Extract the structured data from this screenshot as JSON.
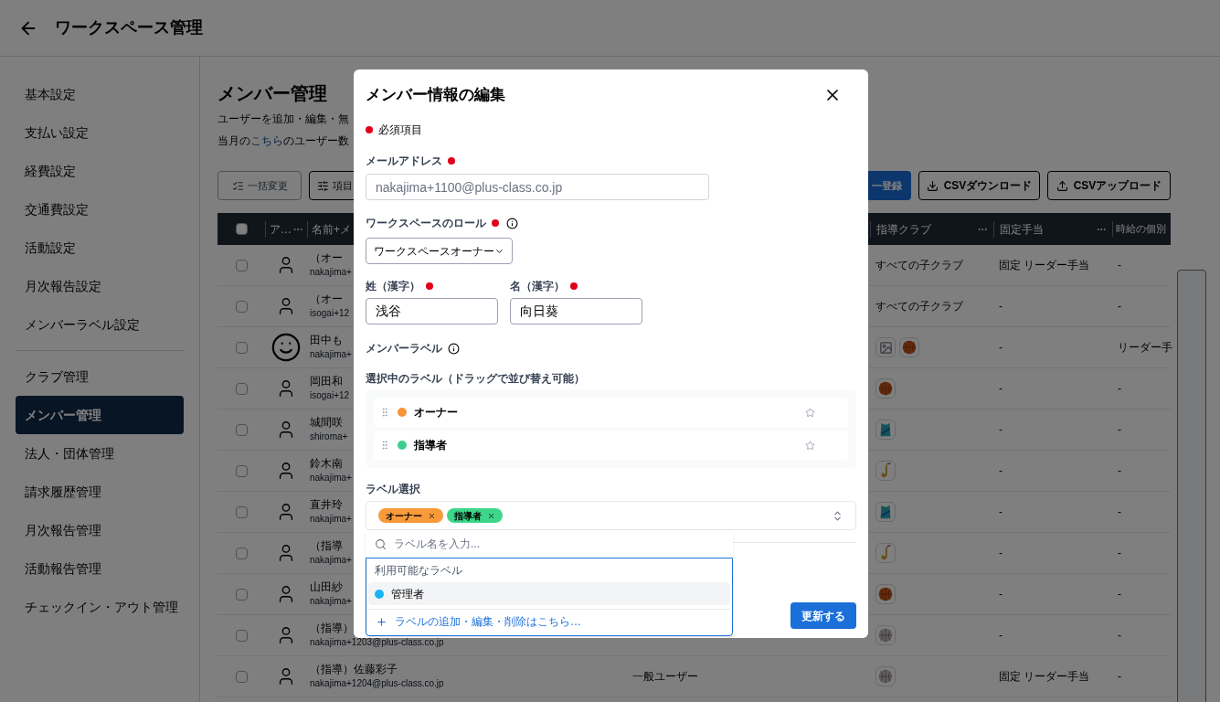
{
  "header": {
    "title": "ワークスペース管理"
  },
  "sidebar": {
    "groups": [
      [
        {
          "label": "基本設定",
          "selected": false
        },
        {
          "label": "支払い設定",
          "selected": false
        },
        {
          "label": "経費設定",
          "selected": false
        },
        {
          "label": "交通費設定",
          "selected": false
        },
        {
          "label": "活動設定",
          "selected": false
        },
        {
          "label": "月次報告設定",
          "selected": false
        },
        {
          "label": "メンバーラベル設定",
          "selected": false
        }
      ],
      [
        {
          "label": "クラブ管理",
          "selected": false
        },
        {
          "label": "メンバー管理",
          "selected": true
        },
        {
          "label": "法人・団体管理",
          "selected": false
        },
        {
          "label": "請求履歴管理",
          "selected": false
        },
        {
          "label": "月次報告管理",
          "selected": false
        },
        {
          "label": "活動報告管理",
          "selected": false
        },
        {
          "label": "チェックイン・アウト管理",
          "selected": false
        }
      ]
    ]
  },
  "page": {
    "title": "メンバー管理",
    "description": "ユーザーを追加・編集・無",
    "note_before": "当月の",
    "note_link": "こちら",
    "note_after": "のユーザー数"
  },
  "toolbar_left": [
    {
      "label": "一括変更",
      "kind": "bulk",
      "disabled": true
    },
    {
      "label": "項目",
      "kind": "columns",
      "disabled": false
    }
  ],
  "toolbar_right": [
    {
      "label": "一登録",
      "kind": "primary"
    },
    {
      "label": "CSVダウンロード",
      "kind": "download"
    },
    {
      "label": "CSVアップロード",
      "kind": "upload"
    }
  ],
  "table": {
    "select_all_checked": false,
    "columns": [
      {
        "label": "ア…"
      },
      {
        "label": "名前+メ"
      },
      {
        "label": "指導クラブ"
      },
      {
        "label": "固定手当"
      },
      {
        "label": "時給の個別"
      }
    ],
    "rows": [
      {
        "checked": false,
        "kind": "person",
        "name": "（オー",
        "email": "nakajima+",
        "club_text": "すべての子クラブ",
        "fixed": "固定 リーダー手当",
        "hourly": "-"
      },
      {
        "checked": false,
        "kind": "person",
        "name": "（オー",
        "email": "isogai+12",
        "club_text": "すべての子クラブ",
        "fixed": "-",
        "hourly": "-"
      },
      {
        "checked": false,
        "kind": "smiley",
        "name": "田中も",
        "email": "nakajima+",
        "club_icons": [
          {
            "kind": "image"
          },
          {
            "kind": "ball"
          }
        ],
        "fixed": "-",
        "hourly": "リーダー手"
      },
      {
        "checked": false,
        "kind": "person",
        "name": "岡田和",
        "email": "isogai+12",
        "club_icons": [
          {
            "kind": "ball"
          }
        ],
        "fixed": "-",
        "hourly": "-"
      },
      {
        "checked": false,
        "kind": "person",
        "name": "城間咲",
        "email": "shiroma+",
        "club_icons": [
          {
            "kind": "shirt"
          }
        ],
        "fixed": "-",
        "hourly": "-"
      },
      {
        "checked": false,
        "kind": "person",
        "name": "鈴木南",
        "email": "nakajima+",
        "club_icons": [
          {
            "kind": "sax"
          }
        ],
        "fixed": "-",
        "hourly": "-"
      },
      {
        "checked": false,
        "kind": "person",
        "name": "直井玲",
        "email": "nakajima+",
        "club_icons": [
          {
            "kind": "shirt"
          }
        ],
        "fixed": "-",
        "hourly": "-"
      },
      {
        "checked": false,
        "kind": "person",
        "name": "（指導",
        "email": "nakajima+",
        "club_icons": [
          {
            "kind": "sax"
          }
        ],
        "fixed": "-",
        "hourly": "-"
      },
      {
        "checked": false,
        "kind": "person",
        "name": "山田紗",
        "email": "nakajima+",
        "club_icons": [
          {
            "kind": "ball"
          }
        ],
        "fixed": "-",
        "hourly": "-"
      },
      {
        "checked": false,
        "kind": "person",
        "name": "（指導）",
        "email": "nakajima+1203@plus-class.co.jp",
        "club_icons": [
          {
            "kind": "greyball"
          }
        ],
        "fixed": "-",
        "hourly": "-"
      },
      {
        "checked": false,
        "kind": "person",
        "name": "（指導）佐藤彩子",
        "email": "nakajima+1204@plus-class.co.jp",
        "role": "一般ユーザー",
        "club_icons": [
          {
            "kind": "greyball"
          }
        ],
        "fixed": "固定 リーダー手当",
        "hourly": "-"
      }
    ]
  },
  "dialog": {
    "title": "メンバー情報の編集",
    "required_note": "必須項目",
    "email": {
      "label": "メールアドレス",
      "required": true,
      "value": "nakajima+1100@plus-class.co.jp",
      "disabled": true
    },
    "role": {
      "label": "ワークスペースのロール",
      "required": true,
      "value": "ワークスペースオーナー"
    },
    "last_name": {
      "label": "姓（漢字）",
      "required": true,
      "value": "浅谷"
    },
    "first_name": {
      "label": "名（漢字）",
      "required": true,
      "value": "向日葵"
    },
    "member_label": {
      "label": "メンバーラベル"
    },
    "selected_labels": {
      "heading": "選択中のラベル（ドラッグで並び替え可能）",
      "items": [
        {
          "name": "オーナー",
          "color": "#f7943a"
        },
        {
          "name": "指導者",
          "color": "#3ed08a"
        }
      ]
    },
    "label_select": {
      "label": "ラベル選択",
      "chips": [
        {
          "name": "オーナー",
          "color": "#f89a3a"
        },
        {
          "name": "指導者",
          "color": "#3ed68a"
        }
      ]
    },
    "dropdown": {
      "placeholder": "ラベル名を入力...",
      "section": "利用可能なラベル",
      "options": [
        {
          "name": "管理者",
          "color": "#1ab4f5",
          "selected": true
        }
      ],
      "add_link": "ラベルの追加・編集・削除はこちら…"
    },
    "submit": "更新する"
  }
}
